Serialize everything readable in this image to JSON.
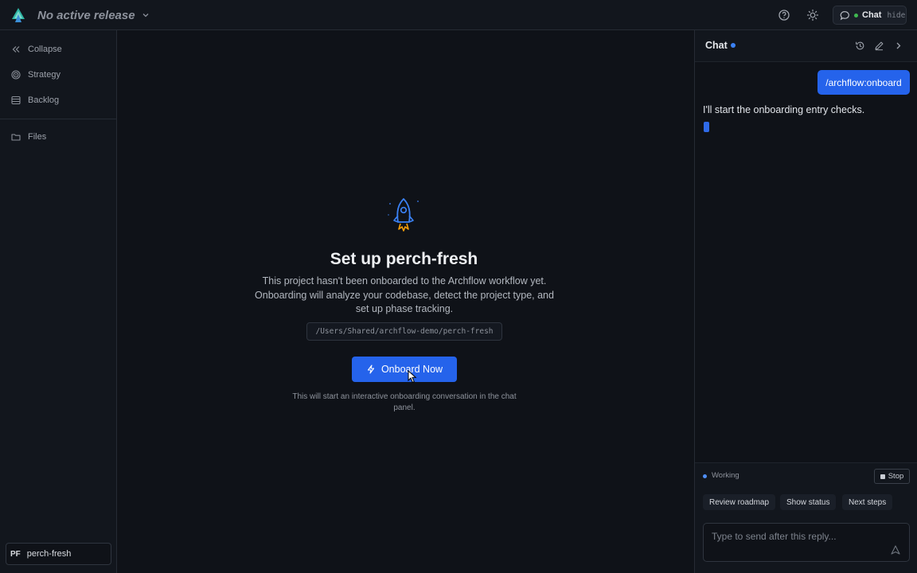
{
  "topbar": {
    "release_label": "No active release",
    "chat_toggle": {
      "label": "Chat",
      "hide_label": "hide",
      "status_color": "#3fb950"
    },
    "icons": [
      "logo-icon",
      "chevron-down-icon",
      "help-icon",
      "sun-icon",
      "chat-bubble-icon"
    ]
  },
  "sidebar": {
    "items": [
      {
        "label": "Collapse",
        "icon": "double-chevron-left-icon"
      },
      {
        "label": "Strategy",
        "icon": "target-icon"
      },
      {
        "label": "Backlog",
        "icon": "list-icon"
      },
      {
        "label": "Files",
        "icon": "folder-icon"
      }
    ],
    "project": {
      "initials": "PF",
      "name": "perch-fresh"
    }
  },
  "main": {
    "title": "Set up perch-fresh",
    "description": "This project hasn't been onboarded to the Archflow workflow yet. Onboarding will analyze your codebase, detect the project type, and set up phase tracking.",
    "path": "/Users/Shared/archflow-demo/perch-fresh",
    "onboard_button": "Onboard Now",
    "hint": "This will start an interactive onboarding conversation in the chat panel."
  },
  "chat": {
    "title": "Chat",
    "status_color": "#3b82f6",
    "messages": [
      {
        "role": "user",
        "text": "/archflow:onboard"
      },
      {
        "role": "assistant",
        "text": "I'll start the onboarding entry checks."
      }
    ],
    "status": {
      "label": "Working",
      "stop_label": "Stop"
    },
    "suggestions": [
      "Review roadmap",
      "Show status",
      "Next steps"
    ],
    "composer": {
      "value": "",
      "placeholder": "Type to send after this reply..."
    }
  },
  "colors": {
    "accent": "#2563eb",
    "background": "#0f1218",
    "panel": "#12161d"
  }
}
